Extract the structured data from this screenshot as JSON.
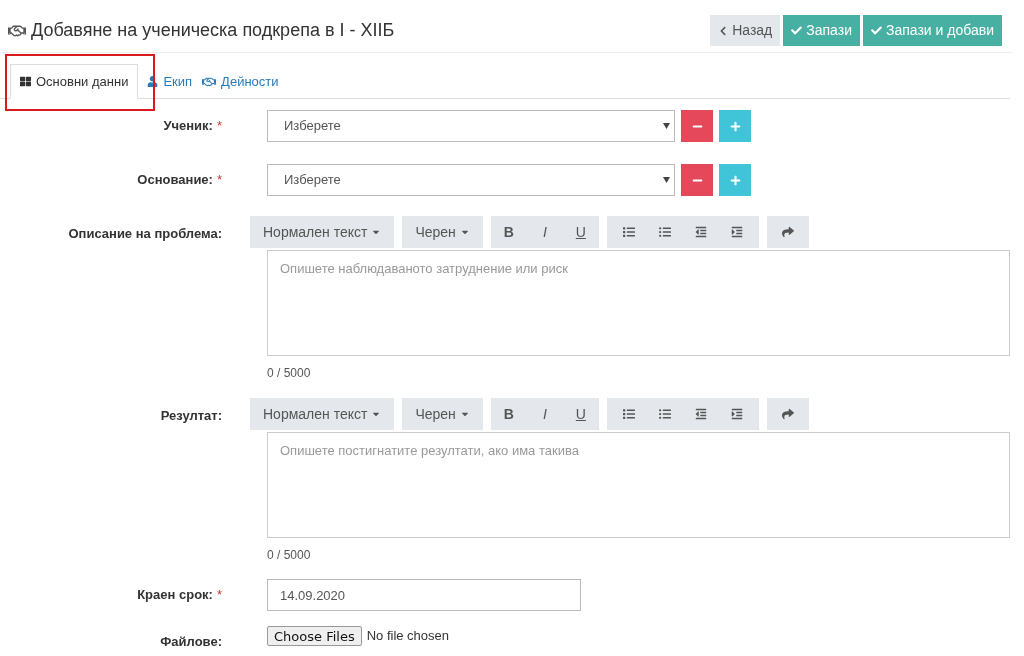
{
  "page": {
    "title": "Добавяне на ученическа подкрепа в I - XIIБ"
  },
  "actions": [
    {
      "kind": "back",
      "label": "Назад"
    },
    {
      "kind": "save",
      "label": "Запази"
    },
    {
      "kind": "save",
      "label": "Запази и добави"
    }
  ],
  "tabs": [
    {
      "kind": "grid",
      "label": "Основни данни",
      "selected": true
    },
    {
      "kind": "user",
      "label": "Екип",
      "selected": false
    },
    {
      "kind": "handshake",
      "label": "Дейности",
      "selected": false
    }
  ],
  "form": [
    {
      "kind": "select",
      "label": "Ученик:",
      "required_mark": "*",
      "value": "Изберете"
    },
    {
      "kind": "select",
      "label": "Основание:",
      "required_mark": "*",
      "value": "Изберете"
    },
    {
      "kind": "editor",
      "label": "Описание на проблема:",
      "style_menu": "Нормален текст",
      "color_menu": "Черен",
      "bold": "B",
      "italic": "I",
      "underline": "U",
      "placeholder": "Опишете наблюдаваното затруднение или риск",
      "counter": "0 / 5000"
    },
    {
      "kind": "editor",
      "label": "Резултат:",
      "style_menu": "Нормален текст",
      "color_menu": "Черен",
      "bold": "B",
      "italic": "I",
      "underline": "U",
      "placeholder": "Опишете постигнатите резултати, ако има такива",
      "counter": "0 / 5000"
    },
    {
      "kind": "date",
      "label": "Краен срок:",
      "required_mark": "*",
      "value": "14.09.2020"
    },
    {
      "kind": "file",
      "label": "Файлове:",
      "button": "Choose Files",
      "status": "No file chosen"
    }
  ]
}
